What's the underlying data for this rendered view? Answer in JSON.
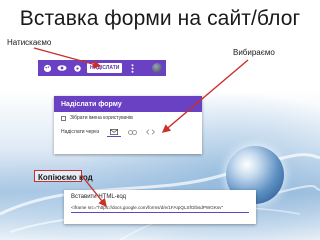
{
  "slide": {
    "title": "Вставка форми на сайт/блог",
    "note_press": "Натискаємо",
    "note_select": "Вибираємо",
    "note_copy": "Копіюємо код"
  },
  "toolbar": {
    "send_label": "НАДІСЛАТИ",
    "icons": [
      "palette-icon",
      "eye-icon",
      "settings-icon",
      "more-vert-icon",
      "avatar"
    ]
  },
  "dialog": {
    "title": "Надіслати форму",
    "collect_emails_label": "Зібрати імена користувачів",
    "send_via_label": "Надіслати через",
    "send_via_options": [
      "email",
      "link",
      "embed"
    ]
  },
  "embed": {
    "title": "Вставити HTML-код",
    "code": "<iframe src=\"https://docs.google.com/forms/d/e/1FAIpQLSfGlbsdPWGKsv\""
  },
  "colors": {
    "accent": "#6b41c4",
    "arrow": "#c9302c",
    "title_text": "#1a1a1a"
  }
}
